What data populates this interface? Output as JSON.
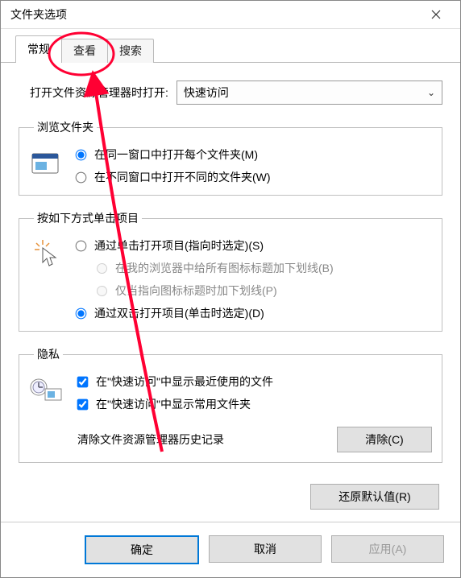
{
  "window": {
    "title": "文件夹选项",
    "close_icon_name": "close-icon"
  },
  "tabs": {
    "general": "常规",
    "view": "查看",
    "search": "搜索",
    "active": "general"
  },
  "open_with": {
    "label": "打开文件资源管理器时打开:",
    "value": "快速访问"
  },
  "browse": {
    "legend": "浏览文件夹",
    "opt_same": "在同一窗口中打开每个文件夹(M)",
    "opt_new": "在不同窗口中打开不同的文件夹(W)",
    "selected": "same"
  },
  "click": {
    "legend": "按如下方式单击项目",
    "opt_single": "通过单击打开项目(指向时选定)(S)",
    "sub_browser": "在我的浏览器中给所有图标标题加下划线(B)",
    "sub_point": "仅当指向图标标题时加下划线(P)",
    "opt_double": "通过双击打开项目(单击时选定)(D)",
    "selected": "double"
  },
  "privacy": {
    "legend": "隐私",
    "show_recent": "在\"快速访问\"中显示最近使用的文件",
    "show_frequent": "在\"快速访问\"中显示常用文件夹",
    "clear_label": "清除文件资源管理器历史记录",
    "clear_button": "清除(C)"
  },
  "restore_defaults": "还原默认值(R)",
  "buttons": {
    "ok": "确定",
    "cancel": "取消",
    "apply": "应用(A)"
  },
  "annotation": {
    "circled_tab": "view",
    "color": "#ff0033"
  }
}
